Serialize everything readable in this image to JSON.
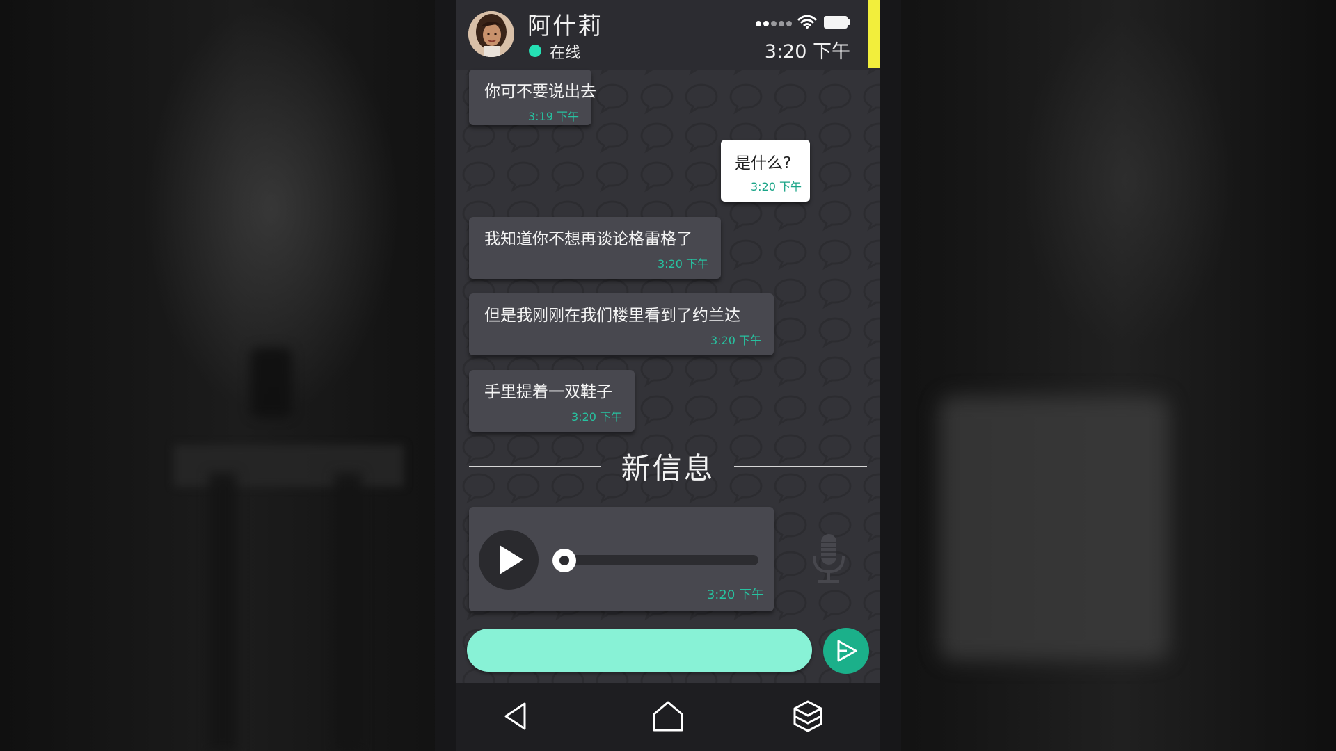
{
  "contact": {
    "name": "阿什莉",
    "status": "在线"
  },
  "status_bar": {
    "time": "3:20 下午",
    "signal_icon": "signal-dots-icon",
    "wifi_icon": "wifi-icon",
    "battery_icon": "battery-icon"
  },
  "messages": [
    {
      "direction": "incoming",
      "text": "你可不要说出去",
      "time": "3:19 下午"
    },
    {
      "direction": "outgoing",
      "text": "是什么?",
      "time": "3:20 下午"
    },
    {
      "direction": "incoming",
      "text": "我知道你不想再谈论格雷格了",
      "time": "3:20 下午"
    },
    {
      "direction": "incoming",
      "text": "但是我刚刚在我们楼里看到了约兰达",
      "time": "3:20 下午"
    },
    {
      "direction": "incoming",
      "text": "手里提着一双鞋子",
      "time": "3:20 下午"
    }
  ],
  "divider": {
    "label": "新信息"
  },
  "voice_message": {
    "time": "3:20 下午",
    "progress": 0.0,
    "play_icon": "play-icon"
  },
  "composer": {
    "value": "",
    "placeholder": "",
    "send_icon": "send-icon",
    "mic_icon": "microphone-icon"
  },
  "nav": {
    "back_icon": "back-icon",
    "home_icon": "home-icon",
    "apps_icon": "apps-icon"
  },
  "colors": {
    "accent": "#25e0b4",
    "input_bg": "#88f2d6",
    "send_button": "#1bb08a",
    "yellow_marker": "#f2ee3c",
    "incoming_bubble": "#48484f",
    "outgoing_bubble": "#ffffff"
  }
}
